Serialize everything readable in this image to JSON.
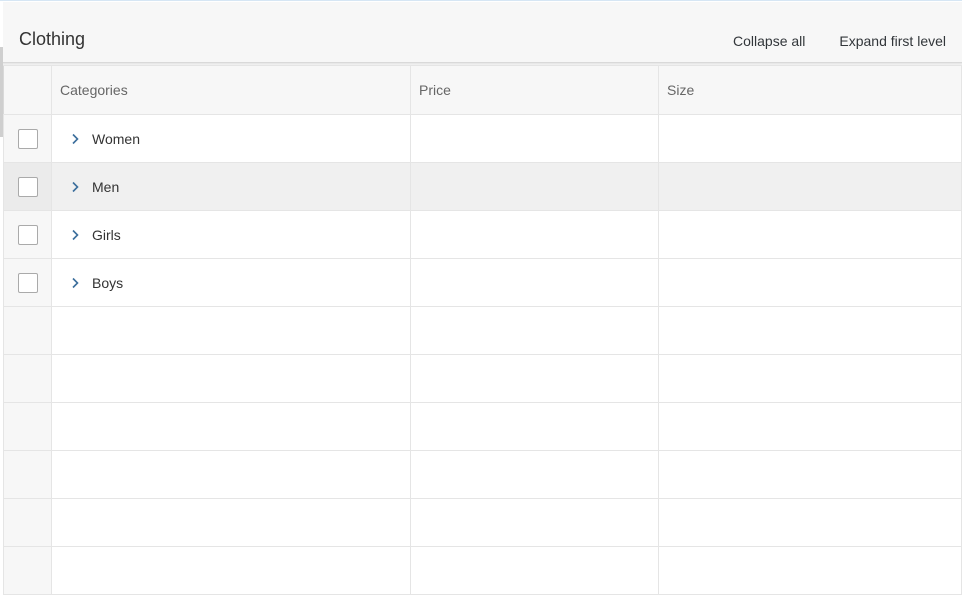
{
  "toolbar": {
    "title": "Clothing",
    "collapse_all_label": "Collapse all",
    "expand_first_level_label": "Expand first level"
  },
  "table": {
    "columns": [
      "Categories",
      "Price",
      "Size"
    ],
    "rows": [
      {
        "category": "Women",
        "price": "",
        "size": "",
        "checked": false,
        "expanded": false
      },
      {
        "category": "Men",
        "price": "",
        "size": "",
        "checked": false,
        "expanded": false,
        "hovered": true
      },
      {
        "category": "Girls",
        "price": "",
        "size": "",
        "checked": false,
        "expanded": false
      },
      {
        "category": "Boys",
        "price": "",
        "size": "",
        "checked": false,
        "expanded": false
      }
    ]
  },
  "icons": {
    "expander": "chevron-right-icon"
  },
  "colors": {
    "header_bg": "#f7f7f7",
    "grid_line": "#e5e5e5",
    "hover_row": "#f0f0f0",
    "chevron": "#3b6e9c",
    "text": "#333333"
  }
}
